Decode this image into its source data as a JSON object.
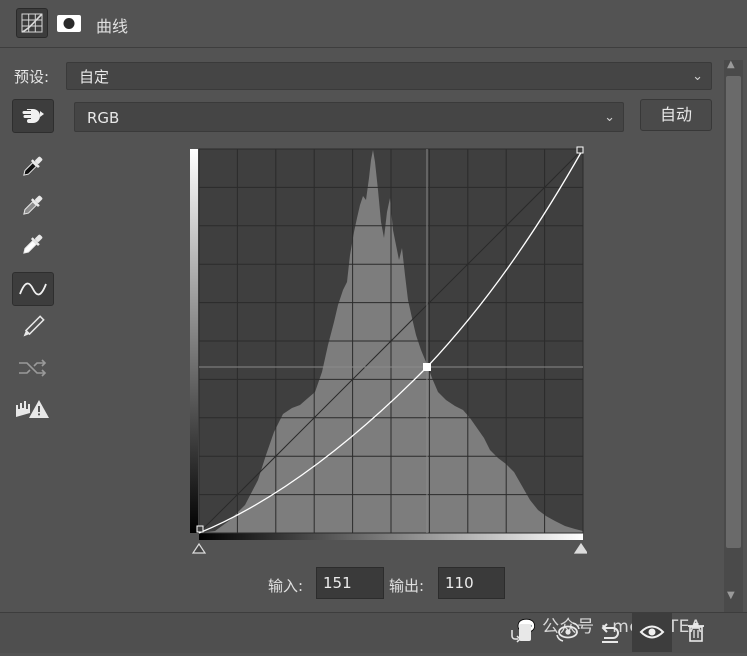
{
  "panel": {
    "title": "曲线"
  },
  "preset": {
    "label": "预设:",
    "value": "自定"
  },
  "channel": {
    "value": "RGB"
  },
  "auto_button": {
    "label": "自动"
  },
  "point": {
    "input_label": "输入:",
    "input_value": "151",
    "output_label": "输出:",
    "output_value": "110"
  },
  "watermark": {
    "text": "公众号 · mediaTEA"
  },
  "icons": {
    "header": [
      "curves-adjustment-icon",
      "mask-icon"
    ],
    "tools": [
      "target-adjust-hand-icon",
      "black-point-eyedropper-icon",
      "gray-point-eyedropper-icon",
      "white-point-eyedropper-icon",
      "curve-point-tool-icon",
      "pencil-draw-icon",
      "smooth-curve-icon",
      "clipping-warning-icon"
    ],
    "bottom": [
      "clip-to-layer-icon",
      "view-previous-state-icon",
      "reset-icon",
      "visibility-eye-icon",
      "delete-trash-icon"
    ]
  }
}
